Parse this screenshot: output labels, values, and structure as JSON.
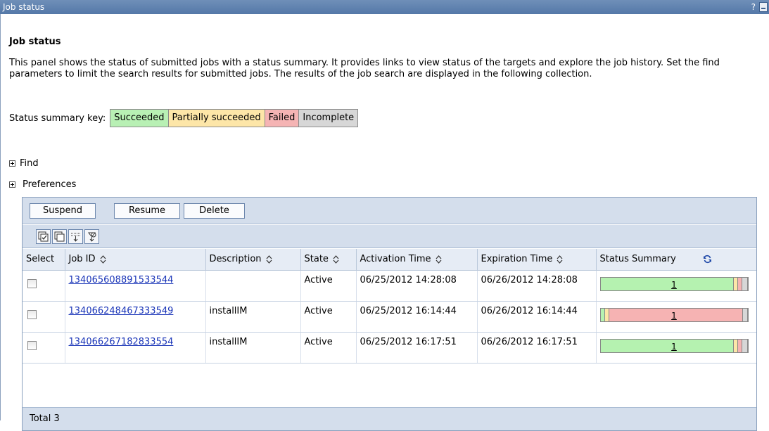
{
  "window": {
    "title": "Job status",
    "help": "?"
  },
  "panel": {
    "heading": "Job status",
    "description": "This panel shows the status of submitted jobs with a status summary. It provides links to view status of the targets and explore the job history. Set the find parameters to limit the search results for submitted jobs. The results of the job search are displayed in the following collection."
  },
  "status_key": {
    "label": "Status summary key:",
    "items": [
      "Succeeded",
      "Partially succeeded",
      "Failed",
      "Incomplete"
    ],
    "colors": {
      "succeeded": "#b8f0b4",
      "partial": "#fde6a8",
      "failed": "#f5b4b4",
      "incomplete": "#d7d7d7"
    }
  },
  "find": {
    "label": "Find"
  },
  "preferences": {
    "label": "Preferences"
  },
  "toolbar": {
    "buttons": [
      "Suspend",
      "Resume",
      "Delete"
    ],
    "icons": [
      "select-all-icon",
      "deselect-all-icon",
      "expand-all-icon",
      "filter-icon"
    ]
  },
  "table": {
    "columns": [
      "Select",
      "Job ID",
      "Description",
      "State",
      "Activation Time",
      "Expiration Time",
      "Status Summary"
    ],
    "rows": [
      {
        "job_id": "134065608891533544",
        "description": "",
        "state": "Active",
        "activation": "06/25/2012 14:28:08",
        "expiration": "06/26/2012 14:28:08",
        "summary_count": "1"
      },
      {
        "job_id": "134066248467333549",
        "description": "installIM",
        "state": "Active",
        "activation": "06/25/2012 16:14:44",
        "expiration": "06/26/2012 16:14:44",
        "summary_count": "1"
      },
      {
        "job_id": "134066267182833554",
        "description": "installIM",
        "state": "Active",
        "activation": "06/25/2012 16:17:51",
        "expiration": "06/26/2012 16:17:51",
        "summary_count": "1"
      }
    ],
    "total": "Total 3"
  }
}
